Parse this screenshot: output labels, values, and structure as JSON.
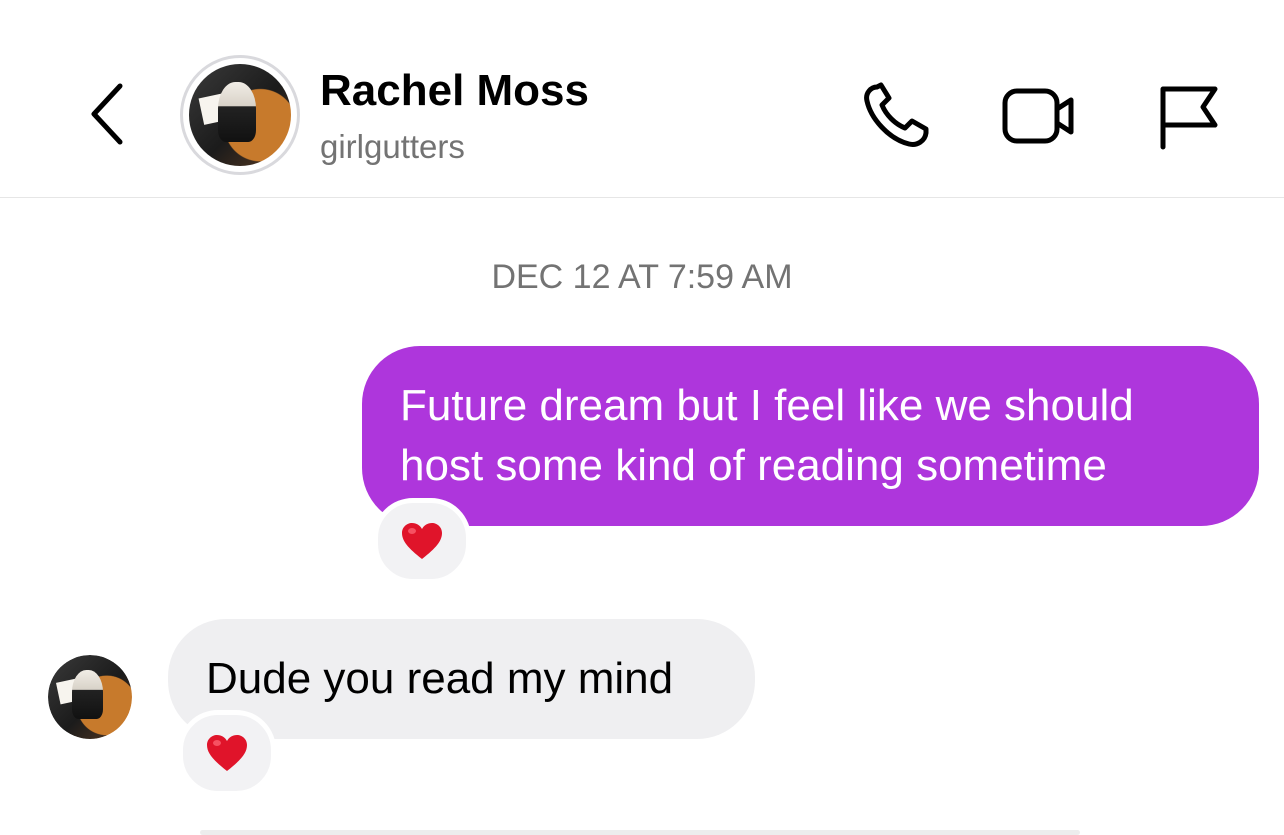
{
  "header": {
    "contact_name": "Rachel Moss",
    "contact_handle": "girlgutters",
    "back_icon": "chevron-left-icon",
    "phone_icon": "phone-icon",
    "video_icon": "video-camera-icon",
    "flag_icon": "flag-icon"
  },
  "conversation": {
    "timestamp": "DEC 12 AT 7:59 AM",
    "messages": [
      {
        "direction": "sent",
        "text_line_1": "Future dream but I feel like we should",
        "text_line_2": "host some kind of reading sometime",
        "reaction": "❤️"
      },
      {
        "direction": "received",
        "text": "Dude you read my mind",
        "reaction": "❤️"
      }
    ]
  },
  "colors": {
    "sent_bubble": "#ae36dc",
    "received_bubble": "#efeff1",
    "secondary_text": "#737373"
  }
}
